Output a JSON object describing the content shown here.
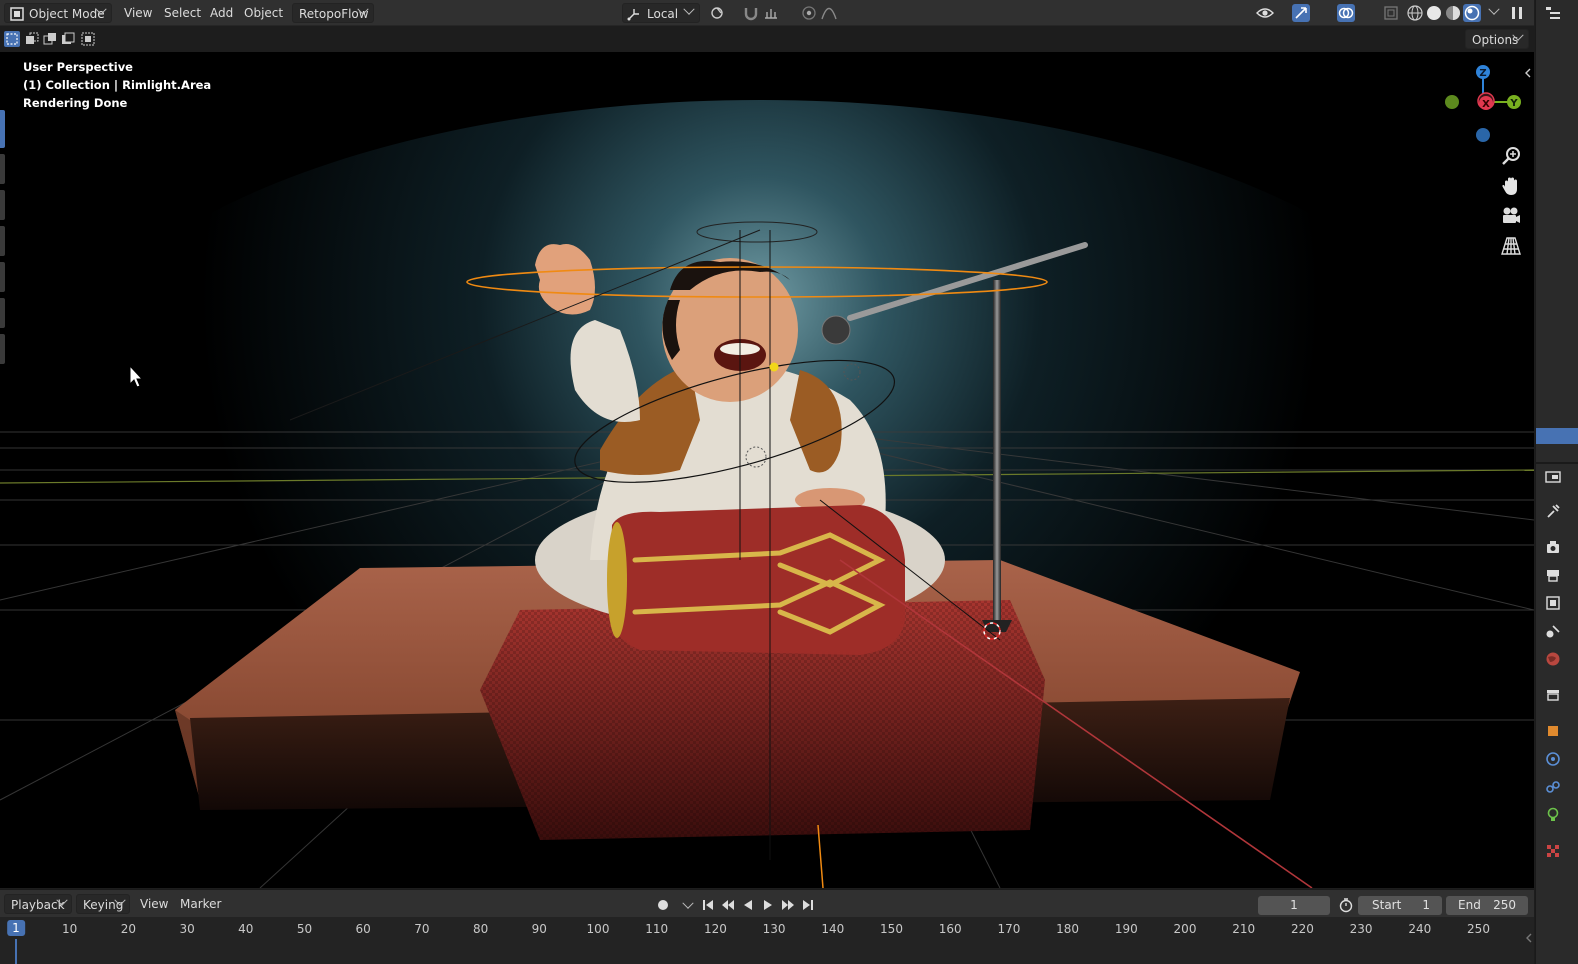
{
  "header": {
    "mode": "Object Mode",
    "menus": [
      "View",
      "Select",
      "Add",
      "Object"
    ],
    "addon_menu": "RetopoFlow",
    "transform_orientation": "Local"
  },
  "toolbar": {
    "options_label": "Options"
  },
  "viewport": {
    "perspective": "User Perspective",
    "collection": "(1) Collection | Rimlight.Area",
    "status": "Rendering Done",
    "gizmo_axes": [
      "Z",
      "X",
      "Y"
    ]
  },
  "timeline": {
    "menus": [
      "Playback",
      "Keying",
      "View",
      "Marker"
    ],
    "current_frame": "1",
    "start_label": "Start",
    "start_value": "1",
    "end_label": "End",
    "end_value": "250",
    "ticks": [
      "1",
      "10",
      "20",
      "30",
      "40",
      "50",
      "60",
      "70",
      "80",
      "90",
      "100",
      "110",
      "120",
      "130",
      "140",
      "150",
      "160",
      "170",
      "180",
      "190",
      "200",
      "210",
      "220",
      "230",
      "240",
      "250"
    ]
  },
  "colors": {
    "accent_blue": "#4772b3",
    "axis_x": "#e0384f",
    "axis_y": "#79b020",
    "axis_z": "#2f83d9",
    "selection_orange": "#f08a12"
  }
}
